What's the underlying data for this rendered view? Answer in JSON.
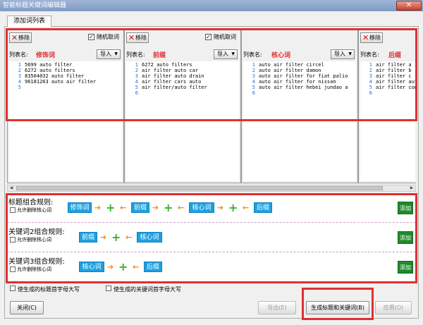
{
  "window": {
    "title": "智能标题关键词编辑器",
    "close": "✕"
  },
  "tab": {
    "label": "添加词列表"
  },
  "panels": [
    {
      "remove": "移除",
      "random_checked": true,
      "random_label": "随机取词",
      "name_label": "列表名:",
      "name": "修饰词",
      "import": "导入",
      "lines": [
        "5699 auto filter",
        "6272 auto filters",
        "83504032 auto filter",
        "96181263 auto air filter",
        "",
        ""
      ]
    },
    {
      "remove": "移除",
      "random_checked": true,
      "random_label": "随机取词",
      "name_label": "列表名:",
      "name": "前缀",
      "import": "导入",
      "lines": [
        "6272 auto filters",
        "air filter auto car",
        "air filter auto drain",
        "air filter cars auto",
        "air filter/auto filter",
        ""
      ]
    },
    {
      "remove": "",
      "random_checked": false,
      "random_label": "",
      "name_label": "列表名:",
      "name": "核心词",
      "import": "导入",
      "lines": [
        "auto air filter circel",
        "auto air filter damon",
        "auto air filter for fiat palio",
        "auto air filter for nissan",
        "auto air filter hebei jundao a",
        ""
      ]
    },
    {
      "remove": "移除",
      "random_checked": false,
      "random_label": "",
      "name_label": "列表名:",
      "name": "后缀",
      "import": "",
      "lines": [
        "air filter a",
        "air filter b",
        "air filter c",
        "air filter auto",
        "air filter con",
        ""
      ]
    }
  ],
  "rules": [
    {
      "title": "标题组合规则:",
      "allow_label": "允许删除核心词",
      "tokens": [
        "修饰词",
        "前缀",
        "核心词",
        "后缀"
      ],
      "add": "添加"
    },
    {
      "title": "关键词2组合规则:",
      "allow_label": "允许删除核心词",
      "tokens": [
        "前缀",
        "核心词"
      ],
      "add": "添加"
    },
    {
      "title": "关键词3组合规则:",
      "allow_label": "允许删除核心词",
      "tokens": [
        "核心词",
        "后缀"
      ],
      "add": "添加"
    }
  ],
  "options": {
    "title_capital": "使生成的标题首字母大写",
    "keyword_capital": "使生成的关键词首字母大写"
  },
  "buttons": {
    "close": "关闭(C)",
    "export": "导出(E)",
    "generate": "生成标题和关键词(B)",
    "apply": "应用(O)"
  },
  "colors": {
    "accent_red": "#e03030",
    "token_blue": "#1ba1e2",
    "add_green": "#1f8a2a",
    "arrow_orange": "#f08a1a",
    "plus_green": "#3cb030"
  }
}
